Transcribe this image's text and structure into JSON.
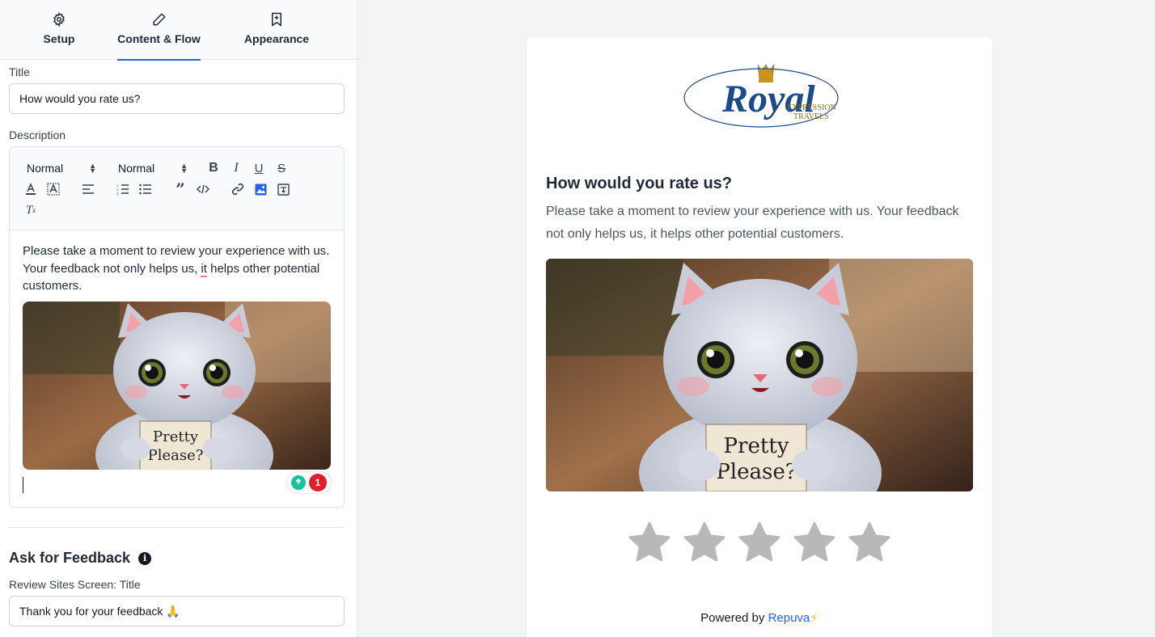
{
  "tabs": [
    {
      "label": "Setup",
      "icon": "gear-icon"
    },
    {
      "label": "Content & Flow",
      "icon": "pencil-icon"
    },
    {
      "label": "Appearance",
      "icon": "bookmark-icon"
    }
  ],
  "active_tab": "Content & Flow",
  "form": {
    "title_label": "Title",
    "title_value": "How would you rate us?",
    "description_label": "Description",
    "toolbar": {
      "font_select": "Normal",
      "size_select": "Normal"
    },
    "description_text_before": "Please take a moment to review your experience with us. Your feedback not only helps us, ",
    "description_text_flag": "it",
    "description_text_after": " helps other potential customers.",
    "grammar_badge_count": "1",
    "ask_feedback_title": "Ask for Feedback",
    "review_sites_label": "Review Sites Screen: Title",
    "review_sites_value": "Thank you for your feedback 🙏"
  },
  "preview": {
    "logo_text_main": "Royal",
    "logo_text_line1": "EXPRESSION",
    "logo_text_line2": "TRAVELS",
    "title": "How would you rate us?",
    "description": "Please take a moment to review your experience with us. Your feedback not only helps us, it helps other potential customers.",
    "image_sign_line1": "Pretty",
    "image_sign_line2": "Please?",
    "star_count": 5,
    "powered_prefix": "Powered by ",
    "powered_brand": "Repuva",
    "powered_bolt": "⚡"
  },
  "colors": {
    "accent": "#2563eb",
    "star": "#b8b8b8",
    "logo_blue": "#1e3a8a",
    "logo_gold": "#b8860b"
  }
}
